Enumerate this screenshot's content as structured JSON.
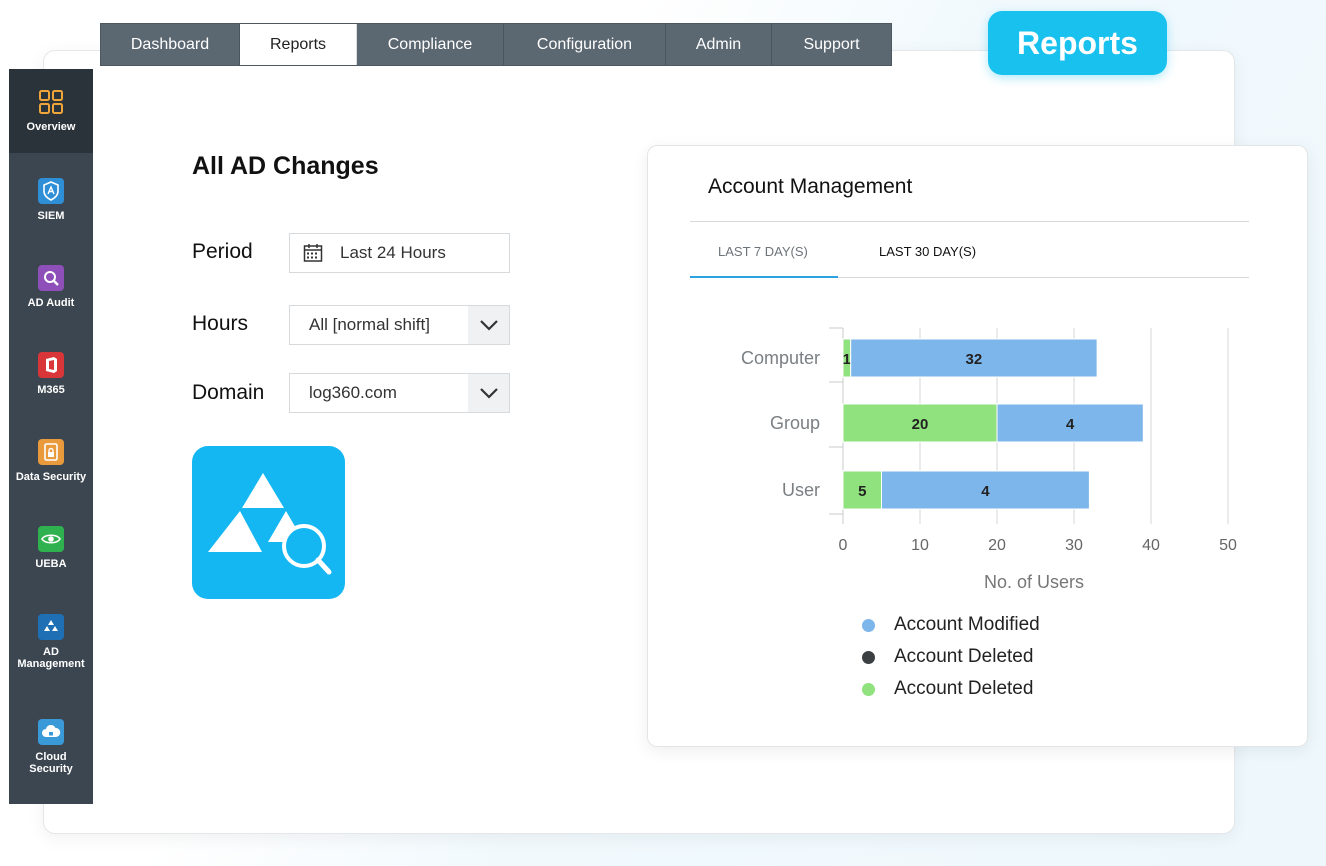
{
  "nav": {
    "tabs": [
      {
        "label": "Dashboard"
      },
      {
        "label": "Reports"
      },
      {
        "label": "Compliance"
      },
      {
        "label": "Configuration"
      },
      {
        "label": "Admin"
      },
      {
        "label": "Support"
      }
    ],
    "active": "Reports"
  },
  "badge": {
    "label": "Reports"
  },
  "sidebar": {
    "items": [
      {
        "label": "Overview",
        "icon": "grid-icon"
      },
      {
        "label": "SIEM",
        "icon": "shield-icon"
      },
      {
        "label": "AD Audit",
        "icon": "magnifier-icon"
      },
      {
        "label": "M365",
        "icon": "office-icon"
      },
      {
        "label": "Data Security",
        "icon": "document-lock-icon"
      },
      {
        "label": "UEBA",
        "icon": "eye-icon"
      },
      {
        "label": "AD Management",
        "icon": "triangle-icon"
      },
      {
        "label": "Cloud Security",
        "icon": "cloud-lock-icon"
      }
    ]
  },
  "form": {
    "title": "All AD Changes",
    "period_label": "Period",
    "period_value": "Last 24 Hours",
    "hours_label": "Hours",
    "hours_value": "All [normal shift]",
    "domain_label": "Domain",
    "domain_value": "log360.com"
  },
  "chart_card": {
    "title": "Account Management",
    "tabs": [
      "LAST 7 DAY(S)",
      "LAST 30 DAY(S)"
    ],
    "active_tab": "LAST 7 DAY(S)"
  },
  "colors": {
    "modified": "#7db6ea",
    "deleted_dark": "#3c3f42",
    "deleted_green": "#8fe27d",
    "accent": "#18c1ee",
    "sidebar": "#3c4650"
  },
  "chart_data": {
    "type": "bar",
    "orientation": "horizontal",
    "stacked": true,
    "categories": [
      "Computer",
      "Group",
      "User"
    ],
    "series": [
      {
        "name": "Account Deleted",
        "color": "#8fe27d",
        "values": [
          1,
          20,
          5
        ],
        "labels": [
          "1",
          "20",
          "5"
        ]
      },
      {
        "name": "Account Modified",
        "color": "#7db6ea",
        "values": [
          32,
          19,
          27
        ],
        "labels": [
          "32",
          "4",
          "4"
        ]
      }
    ],
    "legend": [
      {
        "name": "Account Modified",
        "color": "#7db6ea"
      },
      {
        "name": "Account Deleted",
        "color": "#3c3f42"
      },
      {
        "name": "Account Deleted",
        "color": "#8fe27d"
      }
    ],
    "xlabel": "No. of Users",
    "xlim": [
      0,
      50
    ],
    "xticks": [
      0,
      10,
      20,
      30,
      40,
      50
    ],
    "grid": true,
    "legend_position": "bottom"
  }
}
